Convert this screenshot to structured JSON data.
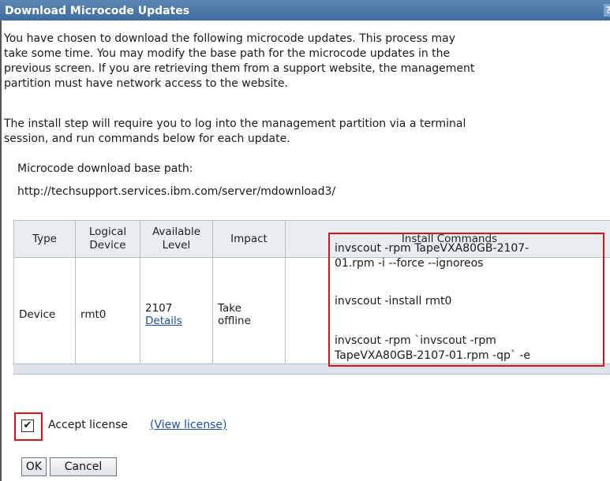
{
  "dialog": {
    "title": "Download Microcode Updates",
    "help_glyph": "?"
  },
  "intro": {
    "line1": "You have chosen to download the following microcode updates. This process may",
    "line2": "take some time. You may modify the base path for the microcode updates in the",
    "line3": "previous screen. If you are retrieving them from a support website, the management",
    "line4": "partition must have network access to the website."
  },
  "install_note": {
    "line1": "The install step will require you to log into the management partition via a terminal",
    "line2": "session, and run commands below for each update."
  },
  "base_path": {
    "label": "Microcode download base path:",
    "value": "http://techsupport.services.ibm.com/server/mdownload3/"
  },
  "table": {
    "headers": {
      "type": "Type",
      "logical_1": "Logical",
      "logical_2": "Device",
      "available_1": "Available",
      "available_2": "Level",
      "impact": "Impact",
      "install": "Install Commands"
    },
    "rows": [
      {
        "type": "Device",
        "device": "rmt0",
        "level": "2107",
        "details_link": "Details",
        "impact_1": "Take",
        "impact_2": "offline",
        "cmd1_a": "invscout -rpm TapeVXA80GB-2107-",
        "cmd1_b": "01.rpm -i --force --ignoreos",
        "cmd2": "invscout -install rmt0",
        "cmd3_a": "invscout -rpm `invscout -rpm",
        "cmd3_b": "TapeVXA80GB-2107-01.rpm -qp` -e"
      }
    ]
  },
  "license": {
    "checked_glyph": "✔",
    "label": "Accept license",
    "view_link": "(View license)"
  },
  "buttons": {
    "ok": "OK",
    "cancel": "Cancel"
  },
  "colors": {
    "title_bar": "#4a78a8",
    "highlight": "#d4161c",
    "link": "#1f4fa8"
  }
}
